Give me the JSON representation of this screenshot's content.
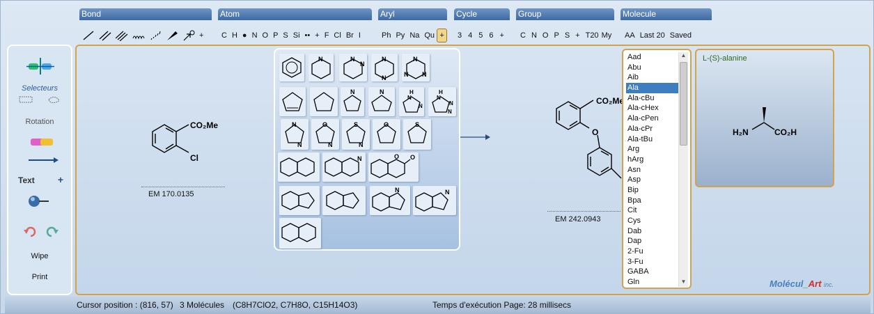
{
  "toolbar": {
    "groups": [
      "Bond",
      "Atom",
      "Aryl",
      "Cycle",
      "Group",
      "Molecule"
    ],
    "bond_plus": "+",
    "atoms": [
      "C",
      "H",
      "●",
      "N",
      "O",
      "P",
      "S",
      "Si",
      "••",
      "+",
      "F",
      "Cl",
      "Br",
      "I"
    ],
    "aryls": [
      "Ph",
      "Py",
      "Na",
      "Qu"
    ],
    "aryl_plus": "+",
    "cycles": [
      "3",
      "4",
      "5",
      "6",
      "+"
    ],
    "groups_items": [
      "C",
      "N",
      "O",
      "P",
      "S",
      "+",
      "T20",
      "My"
    ],
    "molecule_items": [
      "AA",
      "Last 20",
      "Saved"
    ]
  },
  "left_panel": {
    "selecteurs": "Selecteurs",
    "rotation": "Rotation",
    "text": "Text",
    "text_plus": "+",
    "wipe": "Wipe",
    "print": "Print"
  },
  "molecules": [
    {
      "substituent1": "CO₂Me",
      "substituent2": "Cl",
      "em": "EM 170.0135"
    },
    {
      "substituent1": "CO₂Me",
      "substituent2": "O",
      "em": "EM 242.0943"
    }
  ],
  "amino_list": {
    "items": [
      "Aad",
      "Abu",
      "Aib",
      "Ala",
      "Ala-cBu",
      "Ala-cHex",
      "Ala-cPen",
      "Ala-cPr",
      "Ala-tBu",
      "Arg",
      "hArg",
      "Asn",
      "Asp",
      "Bip",
      "Bpa",
      "Cit",
      "Cys",
      "Dab",
      "Dap",
      "2-Fu",
      "3-Fu",
      "GABA",
      "Gln"
    ],
    "selected": "Ala"
  },
  "preview": {
    "title": "L-(S)-alanine",
    "left_label": "H₂N",
    "right_label": "CO₂H"
  },
  "brand": {
    "part1": "Molécul",
    "part2": "Art",
    "part3": "inc."
  },
  "status": {
    "cursor": "Cursor position : (816, 57)",
    "count": "3 Molécules",
    "formulas": "(C8H7ClO2, C7H8O, C15H14O3)",
    "exec": "Temps d'exécution Page: 28 millisecs"
  },
  "colors": {
    "accent": "#3f7dc1",
    "frame": "#d2a24c",
    "tab": "#3d6aa4"
  }
}
